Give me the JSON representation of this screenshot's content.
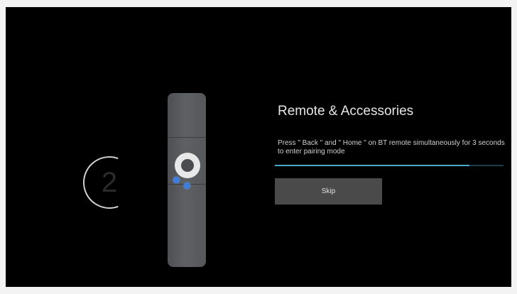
{
  "countdown": {
    "value": "2",
    "ring_color": "#cfcfcf"
  },
  "remote": {
    "dpad_icon": "dpad-ring-icon",
    "highlight_color": "#3d7de0",
    "highlighted_buttons": [
      "back-button-icon",
      "home-button-icon"
    ]
  },
  "pairing": {
    "title": "Remote & Accessories",
    "instruction": "Press \" Back \" and \" Home \" on BT remote simultaneously for 3 seconds to enter pairing mode",
    "progress_fraction": 0.85,
    "accent_color": "#4aa8c8"
  },
  "actions": {
    "skip_label": "Skip"
  }
}
